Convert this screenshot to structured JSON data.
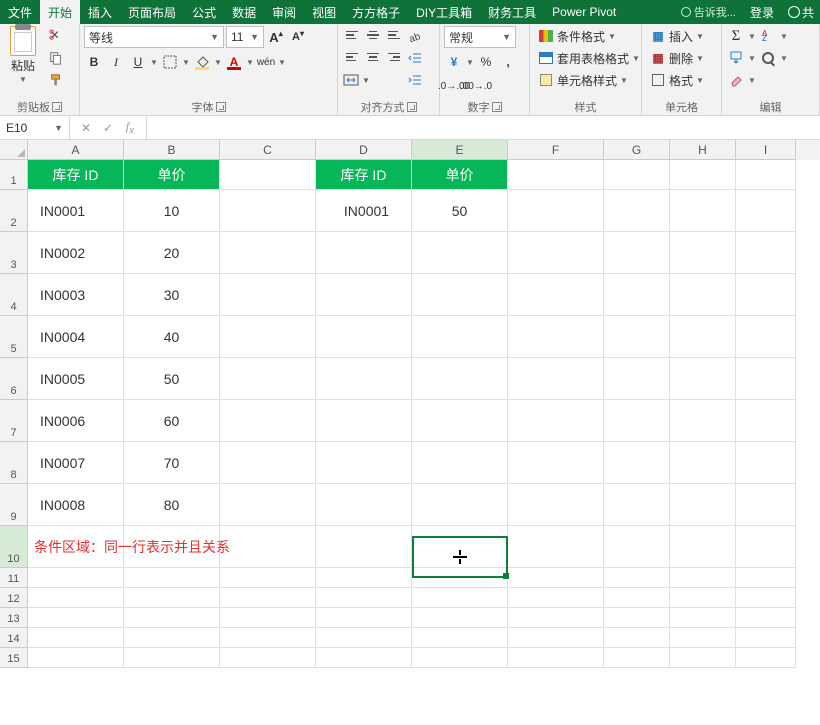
{
  "menu": {
    "items": [
      "文件",
      "开始",
      "插入",
      "页面布局",
      "公式",
      "数据",
      "审阅",
      "视图",
      "方方格子",
      "DIY工具箱",
      "财务工具",
      "Power Pivot"
    ],
    "active_index": 1,
    "tell_me": "告诉我...",
    "login": "登录",
    "share": "共"
  },
  "ribbon": {
    "clipboard": {
      "paste": "粘贴",
      "label": "剪贴板"
    },
    "font": {
      "name": "等线",
      "size": "11",
      "label": "字体",
      "wen": "wén"
    },
    "align": {
      "label": "对齐方式"
    },
    "number": {
      "format": "常规",
      "label": "数字"
    },
    "styles": {
      "cond": "条件格式",
      "tbl": "套用表格格式",
      "cell": "单元格样式",
      "label": "样式"
    },
    "cells": {
      "ins": "插入",
      "del": "删除",
      "fmt": "格式",
      "label": "单元格"
    },
    "edit": {
      "label": "编辑"
    }
  },
  "fbar": {
    "ref": "E10",
    "value": ""
  },
  "cols": [
    "A",
    "B",
    "C",
    "D",
    "E",
    "F",
    "G",
    "H",
    "I"
  ],
  "sheet": {
    "header1": {
      "A": "库存 ID",
      "B": "单价",
      "D": "库存 ID",
      "E": "单价"
    },
    "rows": [
      {
        "A": "IN0001",
        "B": "10",
        "D": "IN0001",
        "E": "50"
      },
      {
        "A": "IN0002",
        "B": "20"
      },
      {
        "A": "IN0003",
        "B": "30"
      },
      {
        "A": "IN0004",
        "B": "40"
      },
      {
        "A": "IN0005",
        "B": "50"
      },
      {
        "A": "IN0006",
        "B": "60"
      },
      {
        "A": "IN0007",
        "B": "70"
      },
      {
        "A": "IN0008",
        "B": "80"
      }
    ],
    "note10": "条件区域：同一行表示并且关系"
  },
  "active": {
    "col": "E",
    "row": 10
  }
}
